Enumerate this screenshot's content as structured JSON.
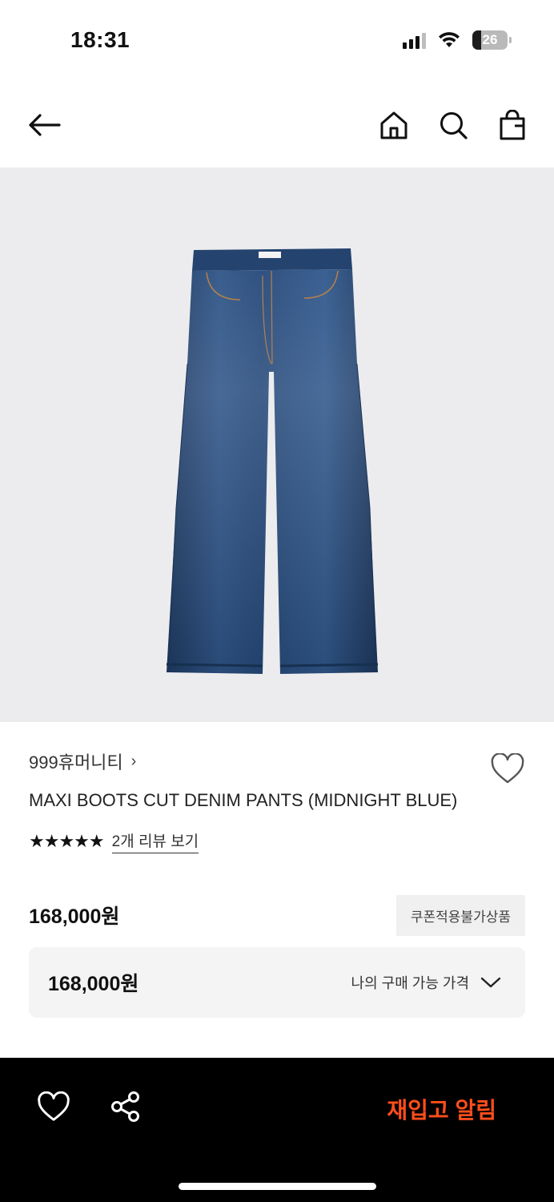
{
  "status_bar": {
    "time": "18:31",
    "battery_percent": "26"
  },
  "nav": {
    "back_icon": "arrow-left-icon",
    "home_icon": "home-icon",
    "search_icon": "search-icon",
    "bag_icon": "shopping-bag-icon"
  },
  "gallery": {
    "image_subject": "blue flared denim pants",
    "current_index": 3,
    "indicator_fraction": 0.6
  },
  "product": {
    "brand": "999휴머니티",
    "brand_chevron": "›",
    "name": "MAXI BOOTS CUT DENIM PANTS (MIDNIGHT BLUE)",
    "rating_stars": 5,
    "stars_text": "★★★★★",
    "review_link": "2개 리뷰 보기",
    "price": "168,000원",
    "coupon_badge": "쿠폰적용불가상품",
    "my_price_value": "168,000원",
    "my_price_label": "나의 구매 가능 가격"
  },
  "bottom_bar": {
    "restock_label": "재입고 알림",
    "accent_color": "#ff4e1b"
  }
}
